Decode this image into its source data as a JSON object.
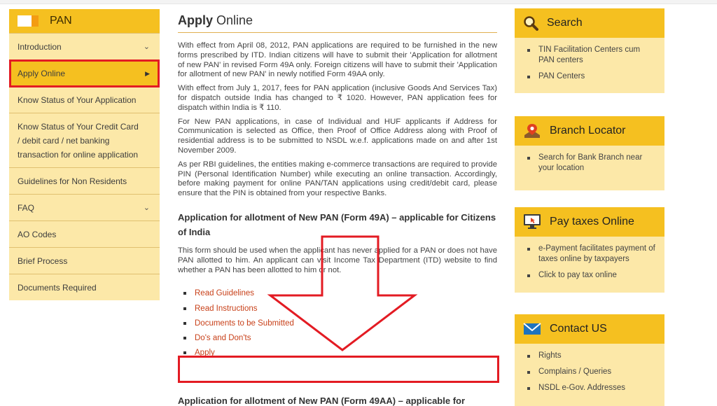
{
  "sidebar": {
    "title": "PAN",
    "items": [
      {
        "label": "Introduction"
      },
      {
        "label": "Apply Online"
      },
      {
        "label": "Know Status of Your Application"
      },
      {
        "label": "Know Status of Your Credit Card / debit card / net banking transaction for online application"
      },
      {
        "label": "Guidelines for Non Residents"
      },
      {
        "label": "FAQ"
      },
      {
        "label": "AO Codes"
      },
      {
        "label": "Brief Process"
      },
      {
        "label": "Documents Required"
      }
    ]
  },
  "main": {
    "title_bold": "Apply",
    "title_rest": " Online",
    "paragraphs": [
      "With effect from April 08, 2012, PAN applications are required to be furnished in the new forms prescribed by ITD. Indian citizens will have to submit their 'Application for allotment of new PAN' in revised Form 49A only. Foreign citizens will have to submit their 'Application for allotment of new PAN' in newly notified Form 49AA only.",
      "With effect from July 1, 2017, fees for PAN application (inclusive Goods And Services Tax) for dispatch outside India has changed to ₹ 1020. However, PAN application fees for dispatch within India is ₹ 110.",
      "For New PAN applications, in case of Individual and HUF applicants if Address for Communication is selected as Office, then Proof of Office Address along with Proof of residential address is to be submitted to NSDL w.e.f. applications made on and after 1st November 2009.",
      "As per RBI guidelines, the entities making e-commerce transactions are required to provide PIN (Personal Identification Number) while executing an online transaction. Accordingly, before making payment for online PAN/TAN applications using credit/debit card, please ensure that the PIN is obtained from your respective Banks."
    ],
    "section1_title": "Application for allotment of New PAN (Form 49A) – applicable for Citizens of India",
    "section1_text": "This form should be used when the applicant has never applied for a PAN or does not have PAN allotted to him. An applicant can visit Income Tax Department (ITD) website to find whether a PAN has been allotted to him or not.",
    "links": [
      {
        "label": "Read Guidelines"
      },
      {
        "label": "Read Instructions"
      },
      {
        "label": "Documents to be Submitted"
      },
      {
        "label": "Do's and Don'ts"
      },
      {
        "label": "Apply"
      }
    ],
    "section2_title": "Application for allotment of New PAN (Form 49AA) – applicable for"
  },
  "right": {
    "search": {
      "title": "Search",
      "items": [
        "TIN Facilitation Centers cum PAN centers",
        "PAN Centers"
      ]
    },
    "branch": {
      "title": "Branch Locator",
      "items": [
        "Search for Bank Branch near your location"
      ]
    },
    "pay": {
      "title": "Pay taxes Online",
      "items": [
        "e-Payment facilitates payment of taxes online by taxpayers",
        "Click to pay tax online"
      ]
    },
    "contact": {
      "title": "Contact US",
      "items": [
        "Rights",
        "Complains / Queries",
        "NSDL e-Gov. Addresses"
      ]
    }
  },
  "colors": {
    "accent": "#f5c020",
    "panel": "#fce8a8",
    "link": "#c8411a",
    "highlight": "#e31b23"
  },
  "icons": [
    "magnifier-icon",
    "map-pin-icon",
    "monitor-icon",
    "envelope-icon",
    "chevron-down-icon",
    "caret-right-icon"
  ]
}
